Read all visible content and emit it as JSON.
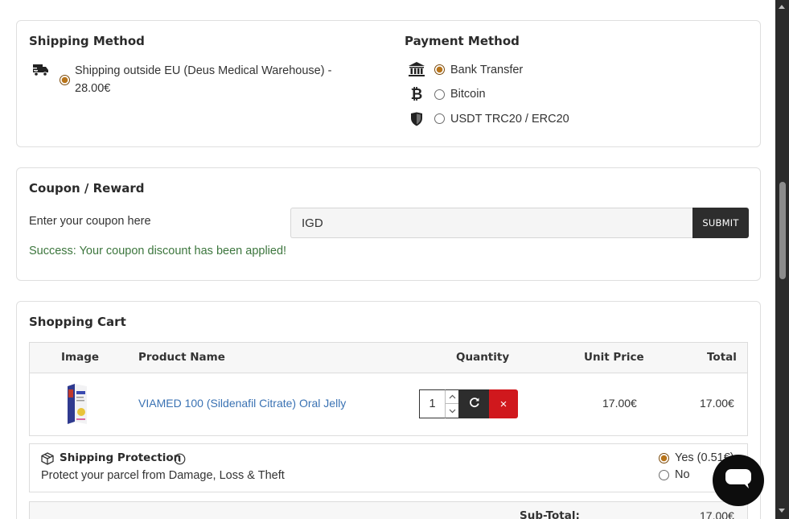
{
  "shipping": {
    "title": "Shipping Method",
    "option_line1": "Shipping outside EU (Deus Medical Warehouse) -",
    "option_line2": "28.00€",
    "icon": "truck-icon"
  },
  "payment": {
    "title": "Payment Method",
    "options": [
      {
        "label": "Bank Transfer",
        "icon": "bank-icon",
        "selected": true
      },
      {
        "label": "Bitcoin",
        "icon": "bitcoin-icon",
        "selected": false
      },
      {
        "label": "USDT TRC20 / ERC20",
        "icon": "shield-icon",
        "selected": false
      }
    ]
  },
  "coupon": {
    "title": "Coupon / Reward",
    "label": "Enter your coupon here",
    "value": "IGD",
    "submit_label": "SUBMIT",
    "success_message": "Success: Your coupon discount has been applied!"
  },
  "cart": {
    "title": "Shopping Cart",
    "headers": {
      "image": "Image",
      "product_name": "Product Name",
      "quantity": "Quantity",
      "unit_price": "Unit Price",
      "total": "Total"
    },
    "items": [
      {
        "name": "VIAMED 100 (Sildenafil Citrate) Oral Jelly",
        "quantity": "1",
        "unit_price": "17.00€",
        "total": "17.00€"
      }
    ],
    "remove_symbol": "×",
    "protection": {
      "title": "Shipping Protection",
      "description": "Protect your parcel from Damage, Loss & Theft",
      "yes_label": "Yes (0.51€)",
      "no_label": "No"
    },
    "subtotal_label": "Sub-Total:",
    "subtotal_value": "17.00€"
  },
  "colors": {
    "accent_radio": "#b8741a",
    "link": "#3a72b3",
    "success": "#3c763d",
    "remove": "#d0181d",
    "dark": "#2d2d2d"
  }
}
